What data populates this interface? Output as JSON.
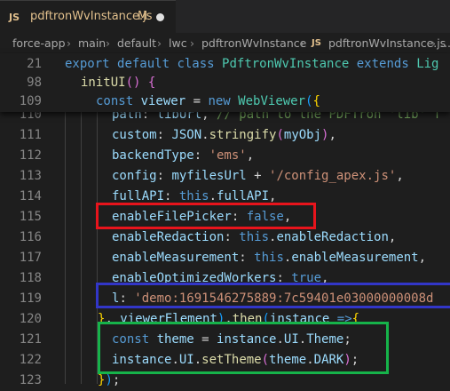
{
  "tab": {
    "js_badge": "JS",
    "filename": "pdftronWvInstance.js",
    "modified": "M"
  },
  "breadcrumb": [
    "force-app",
    "main",
    "default",
    "lwc",
    "pdftronWvInstance",
    "JS",
    "pdftronWvInstance.js",
    "..."
  ],
  "sticky": [
    {
      "num": "21",
      "parts": [
        [
          "kw",
          "export "
        ],
        [
          "kw",
          "default "
        ],
        [
          "kw",
          "class "
        ],
        [
          "cls",
          "PdftronWvInstance "
        ],
        [
          "kw",
          "extends "
        ],
        [
          "cls",
          "Lig"
        ]
      ]
    },
    {
      "num": "98",
      "parts": [
        [
          "fn",
          "initUI"
        ],
        [
          "br2",
          "() "
        ],
        [
          "br2",
          "{"
        ]
      ]
    },
    {
      "num": "109",
      "parts": [
        [
          "kw",
          "const "
        ],
        [
          "var",
          "viewer "
        ],
        [
          "pl",
          "= "
        ],
        [
          "kw",
          "new "
        ],
        [
          "cls",
          "WebViewer"
        ],
        [
          "br3",
          "("
        ],
        [
          "br1",
          "{"
        ]
      ]
    }
  ],
  "lines": [
    {
      "num": "110",
      "parts": [
        [
          "var",
          "path"
        ],
        [
          "pl",
          ": "
        ],
        [
          "var",
          "libUrl"
        ],
        [
          "pl",
          ", "
        ],
        [
          "cmt",
          "// path to the PDFTron 'lib' f"
        ]
      ]
    },
    {
      "num": "111",
      "parts": [
        [
          "var",
          "custom"
        ],
        [
          "pl",
          ": "
        ],
        [
          "var",
          "JSON"
        ],
        [
          "pl",
          "."
        ],
        [
          "fn",
          "stringify"
        ],
        [
          "br2",
          "("
        ],
        [
          "var",
          "myObj"
        ],
        [
          "br2",
          ")"
        ],
        [
          "pl",
          ","
        ]
      ]
    },
    {
      "num": "112",
      "parts": [
        [
          "var",
          "backendType"
        ],
        [
          "pl",
          ": "
        ],
        [
          "str",
          "'ems'"
        ],
        [
          "pl",
          ","
        ]
      ]
    },
    {
      "num": "113",
      "parts": [
        [
          "var",
          "config"
        ],
        [
          "pl",
          ": "
        ],
        [
          "var",
          "myfilesUrl "
        ],
        [
          "pl",
          "+ "
        ],
        [
          "str",
          "'/config_apex.js'"
        ],
        [
          "pl",
          ","
        ]
      ]
    },
    {
      "num": "114",
      "parts": [
        [
          "var",
          "fullAPI"
        ],
        [
          "pl",
          ": "
        ],
        [
          "kw",
          "this"
        ],
        [
          "pl",
          "."
        ],
        [
          "var",
          "fullAPI"
        ],
        [
          "pl",
          ","
        ]
      ]
    },
    {
      "num": "115",
      "parts": [
        [
          "var",
          "enableFilePicker"
        ],
        [
          "pl",
          ": "
        ],
        [
          "kw",
          "false"
        ],
        [
          "pl",
          ","
        ]
      ]
    },
    {
      "num": "116",
      "parts": [
        [
          "var",
          "enableRedaction"
        ],
        [
          "pl",
          ": "
        ],
        [
          "kw",
          "this"
        ],
        [
          "pl",
          "."
        ],
        [
          "var",
          "enableRedaction"
        ],
        [
          "pl",
          ","
        ]
      ]
    },
    {
      "num": "117",
      "parts": [
        [
          "var",
          "enableMeasurement"
        ],
        [
          "pl",
          ": "
        ],
        [
          "kw",
          "this"
        ],
        [
          "pl",
          "."
        ],
        [
          "var",
          "enableMeasurement"
        ],
        [
          "pl",
          ","
        ]
      ]
    },
    {
      "num": "118",
      "parts": [
        [
          "var",
          "enableOptimizedWorkers"
        ],
        [
          "pl",
          ": "
        ],
        [
          "kw",
          "true"
        ],
        [
          "pl",
          ","
        ]
      ]
    },
    {
      "num": "119",
      "parts": [
        [
          "var",
          "l"
        ],
        [
          "pl",
          ": "
        ],
        [
          "str",
          "'demo:1691546275889:7c59401e03000000008d"
        ]
      ]
    },
    {
      "num": "120",
      "parts": [
        [
          "br1",
          "}"
        ],
        [
          "pl",
          ", "
        ],
        [
          "var",
          "viewerElement"
        ],
        [
          "br3",
          ")"
        ],
        [
          "pl",
          "."
        ],
        [
          "fn",
          "then"
        ],
        [
          "br3",
          "("
        ],
        [
          "var",
          "instance "
        ],
        [
          "kw",
          "=>"
        ],
        [
          "br1",
          "{"
        ]
      ]
    },
    {
      "num": "121",
      "parts": [
        [
          "kw",
          "const "
        ],
        [
          "var",
          "theme "
        ],
        [
          "pl",
          "= "
        ],
        [
          "var",
          "instance"
        ],
        [
          "pl",
          "."
        ],
        [
          "var",
          "UI"
        ],
        [
          "pl",
          "."
        ],
        [
          "var",
          "Theme"
        ],
        [
          "pl",
          ";"
        ]
      ]
    },
    {
      "num": "122",
      "parts": [
        [
          "var",
          "instance"
        ],
        [
          "pl",
          "."
        ],
        [
          "var",
          "UI"
        ],
        [
          "pl",
          "."
        ],
        [
          "fn",
          "setTheme"
        ],
        [
          "br2",
          "("
        ],
        [
          "var",
          "theme"
        ],
        [
          "pl",
          "."
        ],
        [
          "var",
          "DARK"
        ],
        [
          "br2",
          ")"
        ],
        [
          "pl",
          ";"
        ]
      ]
    },
    {
      "num": "123",
      "parts": [
        [
          "br1",
          "}"
        ],
        [
          "br3",
          ")"
        ],
        [
          "pl",
          ";"
        ]
      ]
    }
  ],
  "annotation_colors": {
    "red": "#e8141c",
    "blue": "#3236c8",
    "green": "#16b34a"
  }
}
